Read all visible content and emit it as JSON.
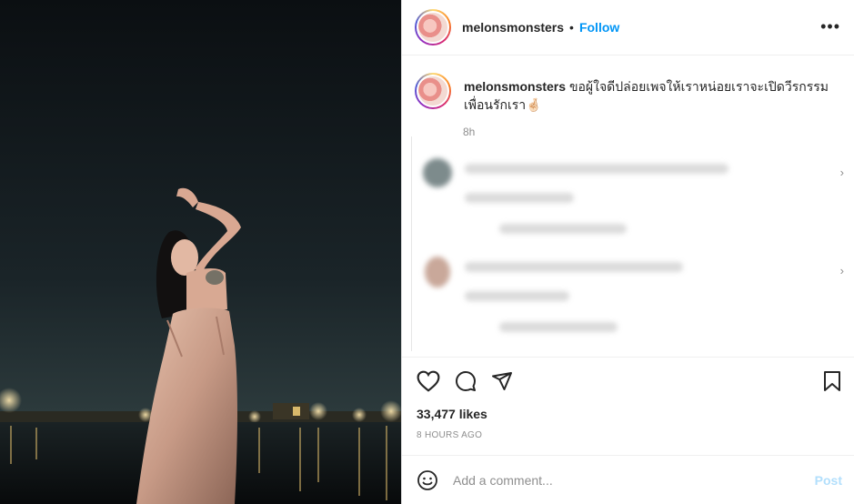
{
  "post": {
    "username": "melonsmonsters",
    "follow_label": "Follow",
    "dot": "•",
    "more_label": "•••",
    "caption_username": "melonsmonsters",
    "caption_text": "ขอผู้ใจดีปล่อยเพจให้เราหน่อยเราจะเปิดวีรกรรมเพื่อนรักเรา🤞🏻",
    "caption_age": "8h",
    "likes": "33,477 likes",
    "posted_ago": "8 HOURS AGO",
    "add_comment_placeholder": "Add a comment...",
    "post_label": "Post"
  },
  "icons": {
    "like": "heart-icon",
    "comment": "comment-icon",
    "share": "share-icon",
    "save": "bookmark-icon",
    "emoji": "emoji-icon",
    "more": "more-options-icon"
  },
  "colors": {
    "follow": "#0095f6",
    "post_disabled": "#b2dffc",
    "muted": "#8e8e8e"
  }
}
